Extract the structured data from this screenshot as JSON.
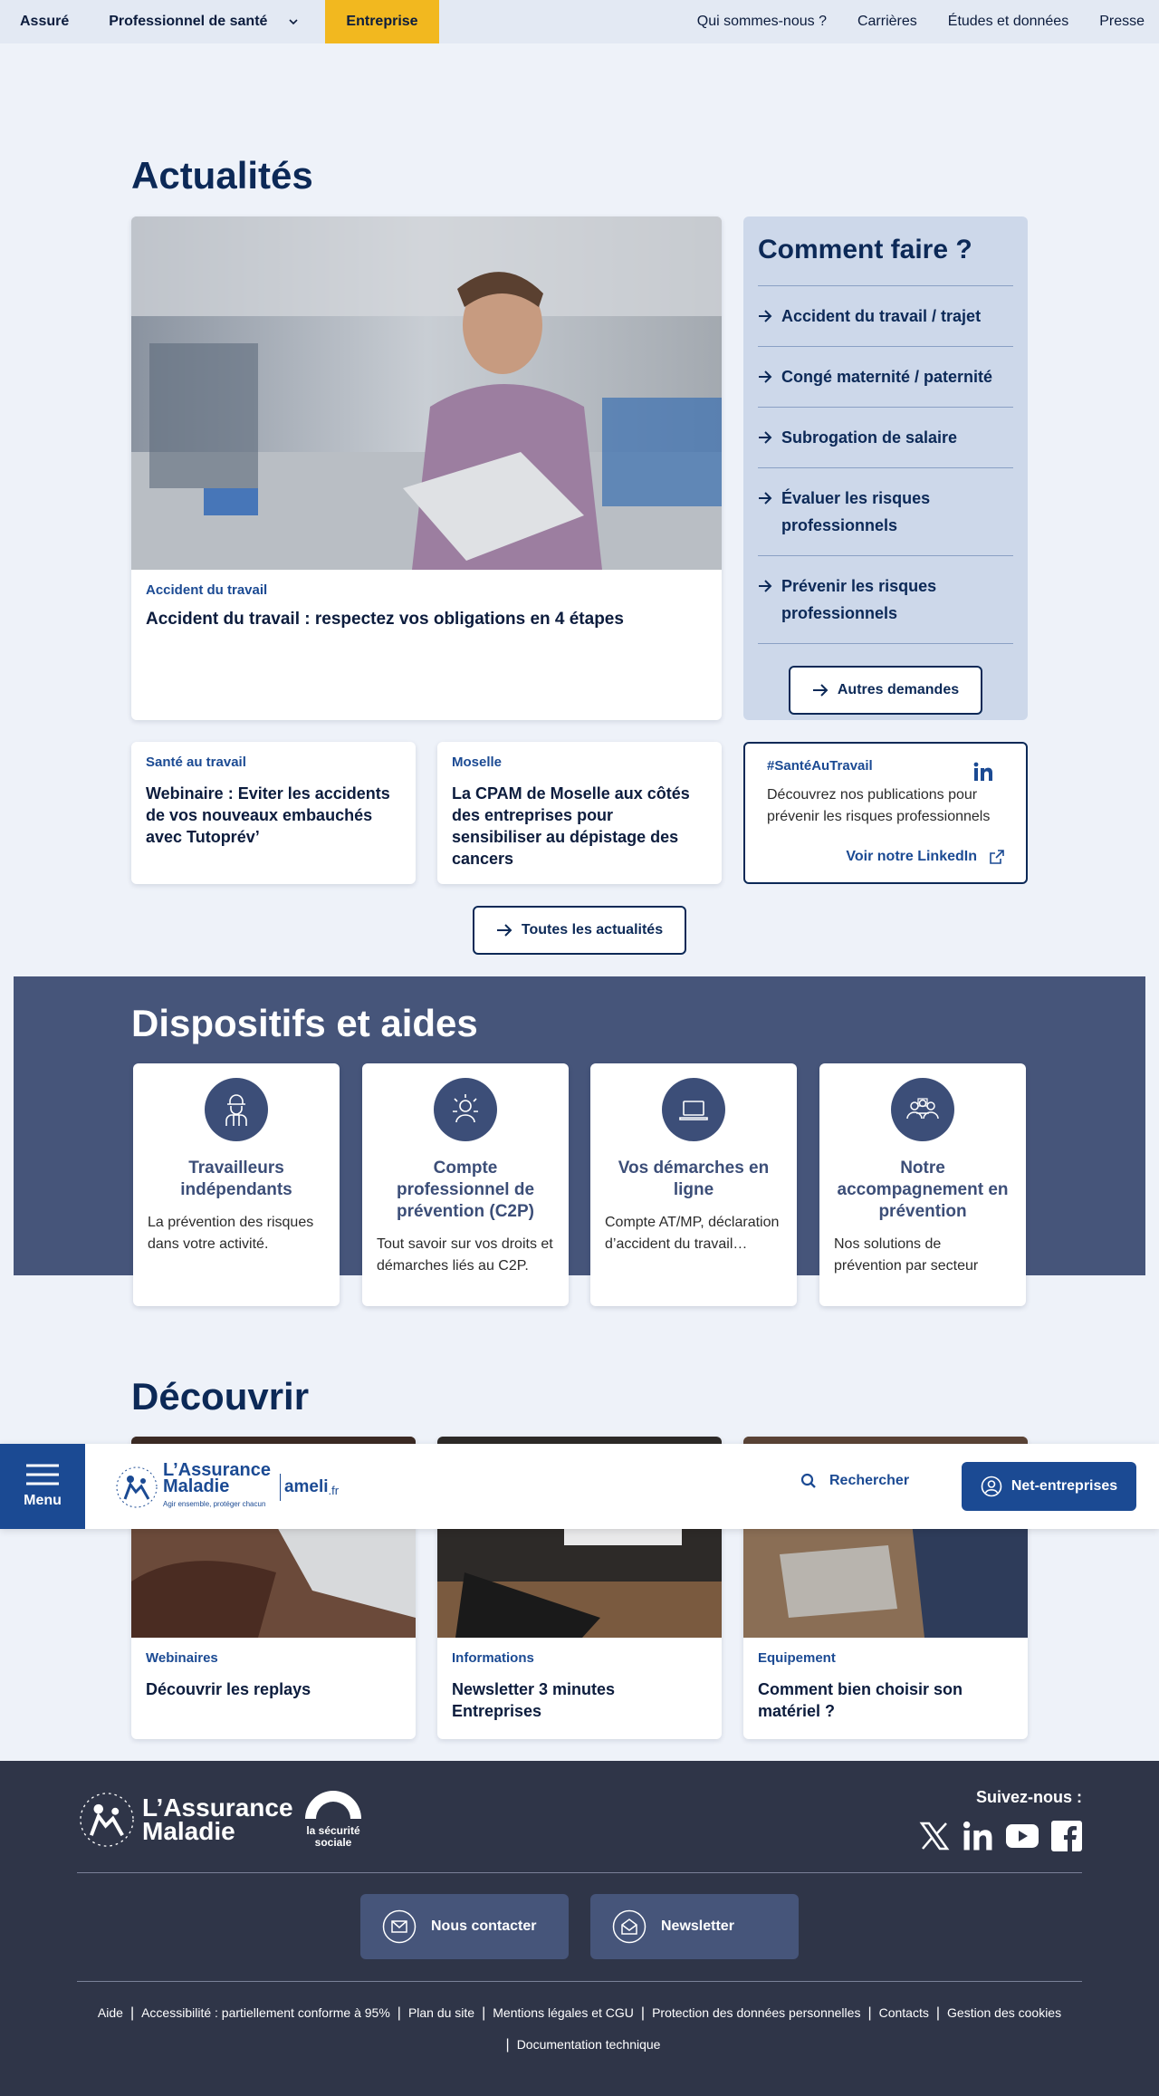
{
  "topbar": {
    "left": [
      "Assuré",
      "Professionnel de santé",
      "Entreprise"
    ],
    "right": [
      "Qui sommes-nous ?",
      "Carrières",
      "Études et données",
      "Presse"
    ]
  },
  "news": {
    "title": "Actualités",
    "featured": {
      "tag": "Accident du travail",
      "title": "Accident du travail : respectez vos obligations en 4 étapes"
    },
    "cards": [
      {
        "tag": "Santé au travail",
        "title": "Webinaire : Eviter les accidents de vos nouveaux embauchés avec Tutoprév’"
      },
      {
        "tag": "Moselle",
        "title": "La CPAM de Moselle aux côtés des entreprises pour sensibiliser au dépistage des cancers"
      }
    ],
    "linkedin": {
      "tag": "#SantéAuTravail",
      "desc": "Découvrez nos publications pour prévenir les risques professionnels",
      "link": "Voir notre LinkedIn"
    },
    "all_button": "Toutes les actualités"
  },
  "howto": {
    "title": "Comment faire ?",
    "items": [
      "Accident du travail / trajet",
      "Congé maternité / paternité",
      "Subrogation de salaire",
      "Évaluer les risques professionnels",
      "Prévenir les risques professionnels"
    ],
    "button": "Autres demandes"
  },
  "dispositifs": {
    "title": "Dispositifs et aides",
    "cards": [
      {
        "title": "Travailleurs indépendants",
        "desc": "La prévention des risques dans votre activité.",
        "icon": "worker-icon"
      },
      {
        "title": "Compte professionnel de prévention (C2P)",
        "desc": "Tout savoir sur vos droits et démarches liés au C2P.",
        "icon": "c2p-icon"
      },
      {
        "title": "Vos démarches en ligne",
        "desc": "Compte AT/MP, déclaration d’accident du travail…",
        "icon": "laptop-icon"
      },
      {
        "title": "Notre accompagnement en prévention",
        "desc": "Nos solutions de prévention par secteur",
        "icon": "group-icon"
      }
    ]
  },
  "discover": {
    "title": "Découvrir",
    "cards": [
      {
        "tag": "Webinaires",
        "title": "Découvrir les replays"
      },
      {
        "tag": "Informations",
        "title": "Newsletter 3 minutes Entreprises"
      },
      {
        "tag": "Equipement",
        "title": "Comment bien choisir son matériel ?"
      }
    ]
  },
  "stickybar": {
    "menu": "Menu",
    "logo_line1": "L’Assurance",
    "logo_line2": "Maladie",
    "logo_tagline": "Agir ensemble, protéger chacun",
    "ameli": "ameli",
    "ameli_suffix": ".fr",
    "search": "Rechercher",
    "net": "Net-entreprises"
  },
  "footer": {
    "logo_line1": "L’Assurance",
    "logo_line2": "Maladie",
    "secu_line1": "la sécurité",
    "secu_line2": "sociale",
    "follow": "Suivez-nous :",
    "contact": "Nous contacter",
    "newsletter": "Newsletter",
    "links": [
      "Aide",
      "Accessibilité : partiellement conforme à 95%",
      "Plan du site",
      "Mentions légales et CGU",
      "Protection des données personnelles",
      "Contacts",
      "Gestion des cookies"
    ],
    "links2": [
      "Documentation technique"
    ]
  },
  "colors": {
    "accent": "#f2b81f",
    "navy": "#0c2957",
    "band": "#46557a",
    "footer": "#2f3548"
  }
}
